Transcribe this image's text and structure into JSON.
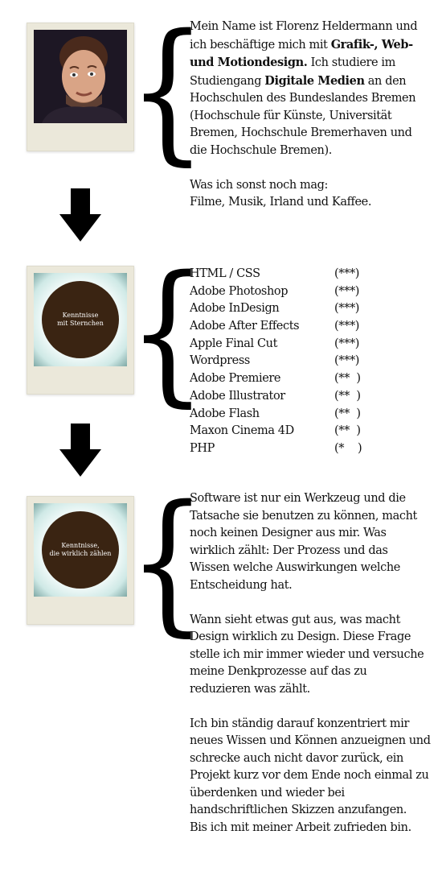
{
  "section1": {
    "polaroid": "portrait-photo",
    "bio": [
      {
        "text": "Mein Name ist Florenz Heldermann und ich beschäftige mich mit "
      },
      {
        "text": "Grafik-, Web- und Motiondesign.",
        "bold": true
      },
      {
        "text": " Ich studiere im Studiengang "
      },
      {
        "text": "Digitale Medien",
        "bold": true
      },
      {
        "text": " an den Hochschulen des Bundeslandes Bremen (Hochschule für Künste, Universität Bremen, Hochschule Bremerhaven und die Hochschule Bremen)."
      }
    ],
    "likes_title": "Was ich sonst noch mag:",
    "likes": "Filme, Musik, Irland und Kaffee."
  },
  "section2": {
    "circle_label": "Kenntnisse\nmit Sternchen",
    "skills": [
      {
        "name": "HTML / CSS",
        "rating": "(***)"
      },
      {
        "name": "Adobe Photoshop",
        "rating": "(***)"
      },
      {
        "name": "Adobe InDesign",
        "rating": "(***)"
      },
      {
        "name": "Adobe After Effects",
        "rating": "(***)"
      },
      {
        "name": "Apple Final Cut",
        "rating": "(***)"
      },
      {
        "name": "Wordpress",
        "rating": "(***)"
      },
      {
        "name": "Adobe Premiere",
        "rating": "(**  )"
      },
      {
        "name": "Adobe Illustrator",
        "rating": "(**  )"
      },
      {
        "name": "Adobe Flash",
        "rating": "(**  )"
      },
      {
        "name": "Maxon Cinema 4D",
        "rating": "(**  )"
      },
      {
        "name": "PHP",
        "rating": "(*    )"
      }
    ]
  },
  "section3": {
    "circle_label": "Kenntnisse,\ndie wirklich zählen",
    "paragraph1": "Software ist nur ein Werkzeug und die Tatsache sie benutzen zu können, macht noch keinen Designer aus mir. Was wirklich zählt: Der Prozess und das Wissen welche Auswirkungen welche Entscheidung hat.",
    "paragraph2": "Wann sieht etwas gut aus, was macht Design wirklich zu Design. Diese Frage stelle ich mir immer wieder und versuche meine Denkprozesse auf das zu reduzieren was zählt.",
    "paragraph3": "Ich bin ständig darauf konzentriert mir neues Wissen und Können anzueignen und schrecke auch nicht davor zurück, ein Projekt kurz vor dem Ende noch einmal zu überdenken und wieder bei handschriftlichen Skizzen anzufangen.",
    "paragraph4": "Bis ich mit meiner Arbeit zufrieden bin."
  },
  "colors": {
    "circle": "#3a2412",
    "polaroid_frame": "#ebe8da",
    "arrow": "#000000"
  }
}
